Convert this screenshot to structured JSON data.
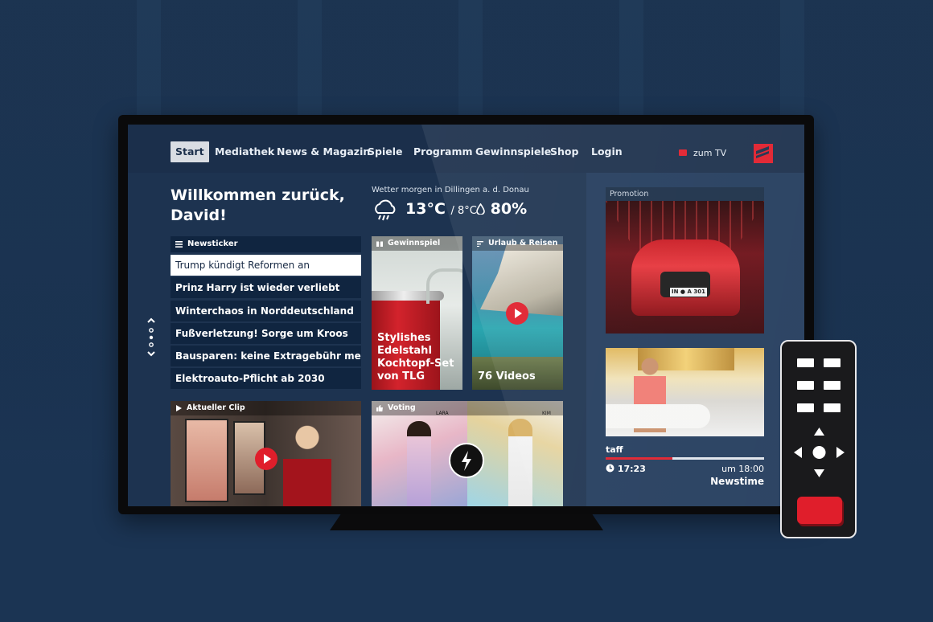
{
  "nav": {
    "items": [
      "Start",
      "Mediathek",
      "News & Magazin",
      "Spiele",
      "Programm",
      "Gewinnspiele",
      "Shop",
      "Login"
    ],
    "active": "Start",
    "zum_tv": "zum TV"
  },
  "welcome": {
    "line1": "Willkommen zurück,",
    "line2": "David!"
  },
  "weather": {
    "caption": "Wetter morgen in Dillingen a. d. Donau",
    "temp_high": "13°C",
    "temp_low": "/ 8°C",
    "humidity": "80%"
  },
  "newsticker": {
    "title": "Newsticker",
    "items": [
      "Trump kündigt Reformen an",
      "Prinz Harry ist wieder verliebt",
      "Winterchaos in Norddeutschland",
      "Fußverletzung! Sorge um Kroos",
      "Bausparen: keine Extragebühr mehr",
      "Elektroauto-Pflicht ab 2030"
    ],
    "selected_index": 0
  },
  "cards": {
    "gewinnspiel": {
      "caption": "Gewinnspiel",
      "title_l1": "Stylishes",
      "title_l2": "Edelstahl",
      "title_l3": "Kochtopf-Set",
      "title_l4": "von TLG"
    },
    "urlaub": {
      "caption": "Urlaub & Reisen",
      "title": "76 Videos"
    },
    "clip": {
      "caption": "Aktueller Clip"
    },
    "voting": {
      "caption": "Voting",
      "left_name": "LARA",
      "right_name": "KIM"
    }
  },
  "promotion": {
    "caption": "Promotion",
    "plate": "IN ● A 301"
  },
  "now_playing": {
    "show": "taff",
    "time_now": "17:23",
    "next_time": "um 18:00",
    "next_show": "Newstime",
    "progress": 0.42
  },
  "colors": {
    "accent": "#e01e2b",
    "nav_bg": "#1b2f4b",
    "panel": "#102540"
  },
  "icons": [
    "menu-icon",
    "gift-icon",
    "travel-icon",
    "play-icon",
    "thumbs-up-icon",
    "clock-icon",
    "rain-cloud-icon",
    "drop-icon",
    "prosieben-logo"
  ]
}
